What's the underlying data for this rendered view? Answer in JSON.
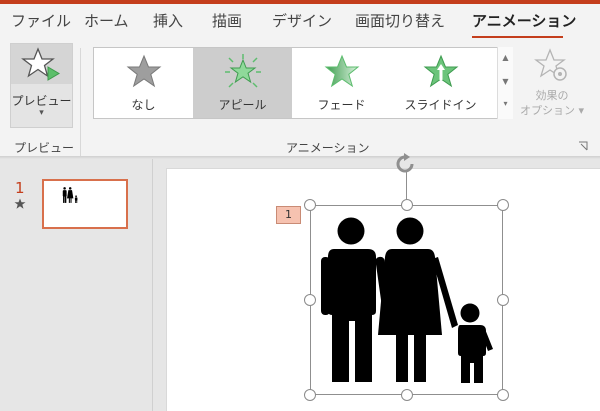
{
  "tabs": [
    {
      "label": "ファイル",
      "active": false
    },
    {
      "label": "ホーム",
      "active": false
    },
    {
      "label": "挿入",
      "active": false
    },
    {
      "label": "描画",
      "active": false
    },
    {
      "label": "デザイン",
      "active": false
    },
    {
      "label": "画面切り替え",
      "active": false
    },
    {
      "label": "アニメーション",
      "active": true
    }
  ],
  "ribbon": {
    "preview_group": {
      "button_label": "プレビュー",
      "caret": "▾",
      "group_label": "プレビュー"
    },
    "animation_group": {
      "items": [
        {
          "label": "なし",
          "icon": "star-gray-icon",
          "selected": false
        },
        {
          "label": "アピール",
          "icon": "star-burst-green-icon",
          "selected": true
        },
        {
          "label": "フェード",
          "icon": "star-fade-green-icon",
          "selected": false
        },
        {
          "label": "スライドイン",
          "icon": "star-arrow-green-icon",
          "selected": false
        }
      ],
      "group_label": "アニメーション",
      "effect_options_label_line1": "効果の",
      "effect_options_label_line2": "オプション ▾"
    }
  },
  "thumbnails": {
    "slide_number": "1"
  },
  "canvas": {
    "animation_badge": "1"
  },
  "colors": {
    "accent": "#c43e1c",
    "animation_green": "#5dbd6e",
    "gallery_selected": "#cdcdcd",
    "badge": "#f6c2b0"
  }
}
